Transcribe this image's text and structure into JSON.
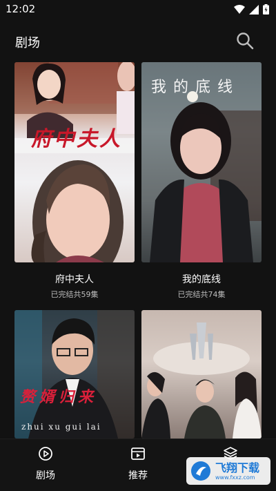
{
  "status": {
    "time": "12:02"
  },
  "header": {
    "title": "剧场"
  },
  "dramas": [
    {
      "title": "府中夫人",
      "status": "已完结共59集",
      "poster_text": "府中夫人"
    },
    {
      "title": "我的底线",
      "status": "已完结共74集",
      "poster_text": "我的底线"
    },
    {
      "poster_text": "赘婿归来",
      "poster_pinyin": "zhui xu gui lai"
    },
    {
      "poster_text": ""
    }
  ],
  "nav": {
    "items": [
      {
        "label": "剧场",
        "icon": "play-circle-icon"
      },
      {
        "label": "推荐",
        "icon": "video-icon"
      },
      {
        "label": "",
        "icon": "layers-icon"
      }
    ]
  },
  "watermark": {
    "text": "飞翔下载",
    "sub": "www.fxxz.com"
  },
  "colors": {
    "background": "#121212",
    "accent": "#1f7ad6"
  }
}
